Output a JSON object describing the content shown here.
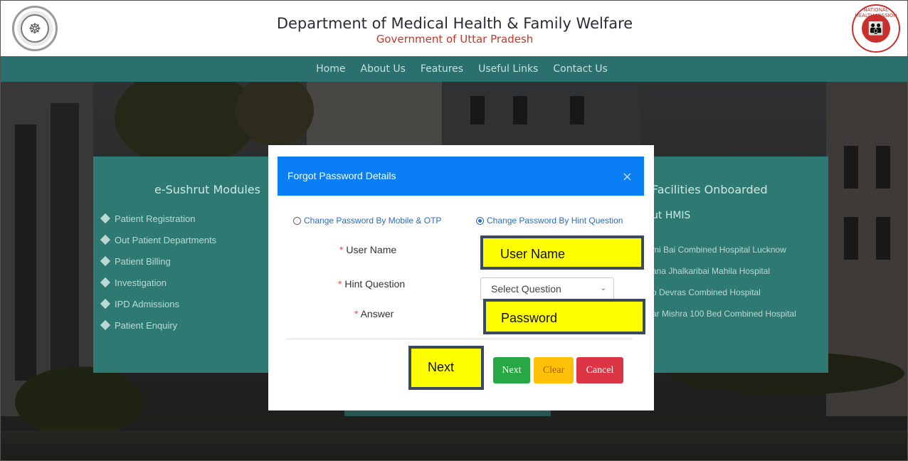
{
  "header": {
    "title": "Department of Medical Health & Family Welfare",
    "subtitle": "Government of Uttar Pradesh",
    "left_logo": "up-govt-emblem-icon",
    "right_logo": "national-health-mission-logo",
    "right_logo_text": "NATIONAL HEALTH MISSION"
  },
  "nav": {
    "items": [
      "Home",
      "About Us",
      "Features",
      "Useful Links",
      "Contact Us"
    ]
  },
  "left_panel": {
    "heading": "e-Sushrut Modules",
    "items": [
      "Patient Registration",
      "Out Patient Departments",
      "Patient Billing",
      "Investigation",
      "IPD Admissions",
      "Patient Enquiry"
    ]
  },
  "right_panel": {
    "heading": "Facilities Onboarded",
    "subheading": "ut HMIS",
    "items": [
      "mi Bai Combined Hospital Lucknow",
      "ana Jhalkaribai Mahila Hospital",
      "o Devras Combined Hospital",
      "ar Mishra 100 Bed Combined Hospital"
    ]
  },
  "modal": {
    "title": "Forgot Password Details",
    "close_label": "×",
    "radio_mobile": "Change Password By Mobile & OTP",
    "radio_hint": "Change Password By Hint Question",
    "selected_option": "Change Password By Hint Question",
    "required_mark": "*",
    "label_username": "User Name",
    "label_hint": "Hint Question",
    "label_answer": "Answer",
    "select_value": "Select Question",
    "buttons": {
      "next": "Next",
      "clear": "Clear",
      "cancel": "Cancel"
    }
  },
  "annotations": {
    "user_name": "User Name",
    "password": "Password",
    "next": "Next"
  },
  "colors": {
    "nav_bg": "#2b6f6e",
    "modal_header": "#0a7ef5",
    "next_button": "#28a745",
    "clear_button": "#ffc107",
    "cancel_button": "#dc3545",
    "annotation": "#ffff00"
  }
}
